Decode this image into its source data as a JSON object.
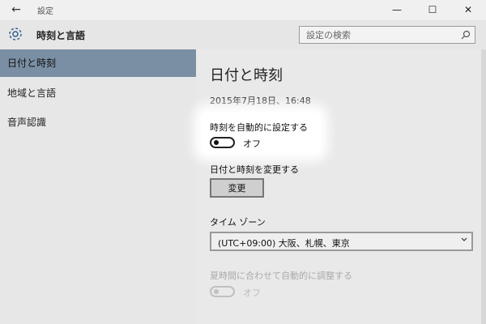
{
  "window": {
    "title": "設定",
    "minimize": "—",
    "maximize": "☐",
    "close": "✕",
    "back": "←"
  },
  "header": {
    "section_title": "時刻と言語",
    "search_placeholder": "設定の検索"
  },
  "sidebar": {
    "items": [
      {
        "label": "日付と時刻",
        "active": true
      },
      {
        "label": "地域と言語",
        "active": false
      },
      {
        "label": "音声認識",
        "active": false
      }
    ]
  },
  "main": {
    "title": "日付と時刻",
    "current_datetime": "2015年7月18日、16:48",
    "auto_time": {
      "label": "時刻を自動的に設定する",
      "state": "オフ"
    },
    "change": {
      "label": "日付と時刻を変更する",
      "button": "変更"
    },
    "timezone": {
      "label": "タイム ゾーン",
      "value": "(UTC+09:00) 大阪、札幌、東京"
    },
    "dst": {
      "label": "夏時間に合わせて自動的に調整する",
      "state": "オフ",
      "enabled": false
    }
  },
  "colors": {
    "accent": "#7a8fa3",
    "background": "#e9e9e9"
  }
}
